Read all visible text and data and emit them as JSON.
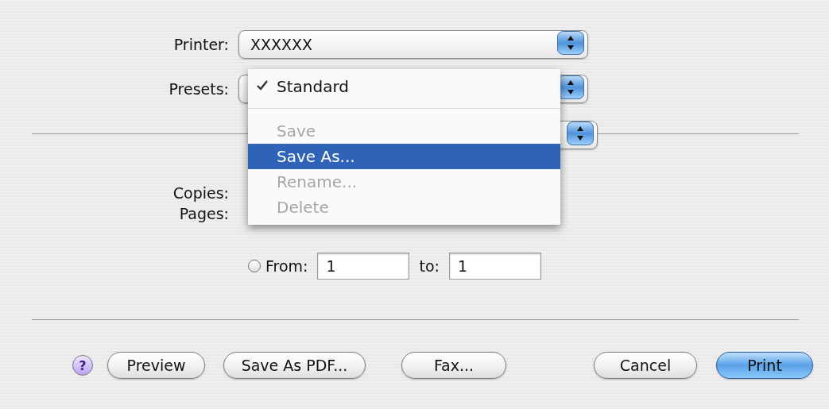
{
  "printer": {
    "label": "Printer:",
    "value": "XXXXXX"
  },
  "presets": {
    "label": "Presets:",
    "menu": [
      {
        "kind": "item",
        "label": "Standard",
        "checked": true,
        "disabled": false,
        "selected": false
      },
      {
        "kind": "separator"
      },
      {
        "kind": "item",
        "label": "Save",
        "checked": false,
        "disabled": true,
        "selected": false
      },
      {
        "kind": "item",
        "label": "Save As...",
        "checked": false,
        "disabled": false,
        "selected": true
      },
      {
        "kind": "item",
        "label": "Rename...",
        "checked": false,
        "disabled": true,
        "selected": false
      },
      {
        "kind": "item",
        "label": "Delete",
        "checked": false,
        "disabled": true,
        "selected": false
      }
    ]
  },
  "copies": {
    "label": "Copies:"
  },
  "pages": {
    "label": "Pages:",
    "options": [
      {
        "label": "From:",
        "selected": false
      }
    ],
    "from": "1",
    "to_label": "to:",
    "to": "1"
  },
  "help": "?",
  "buttons": [
    {
      "label": "Preview",
      "default": false
    },
    {
      "label": "Save As PDF...",
      "default": false
    },
    {
      "label": "Fax...",
      "default": false
    },
    {
      "label": "Cancel",
      "default": false
    },
    {
      "label": "Print",
      "default": true
    }
  ]
}
